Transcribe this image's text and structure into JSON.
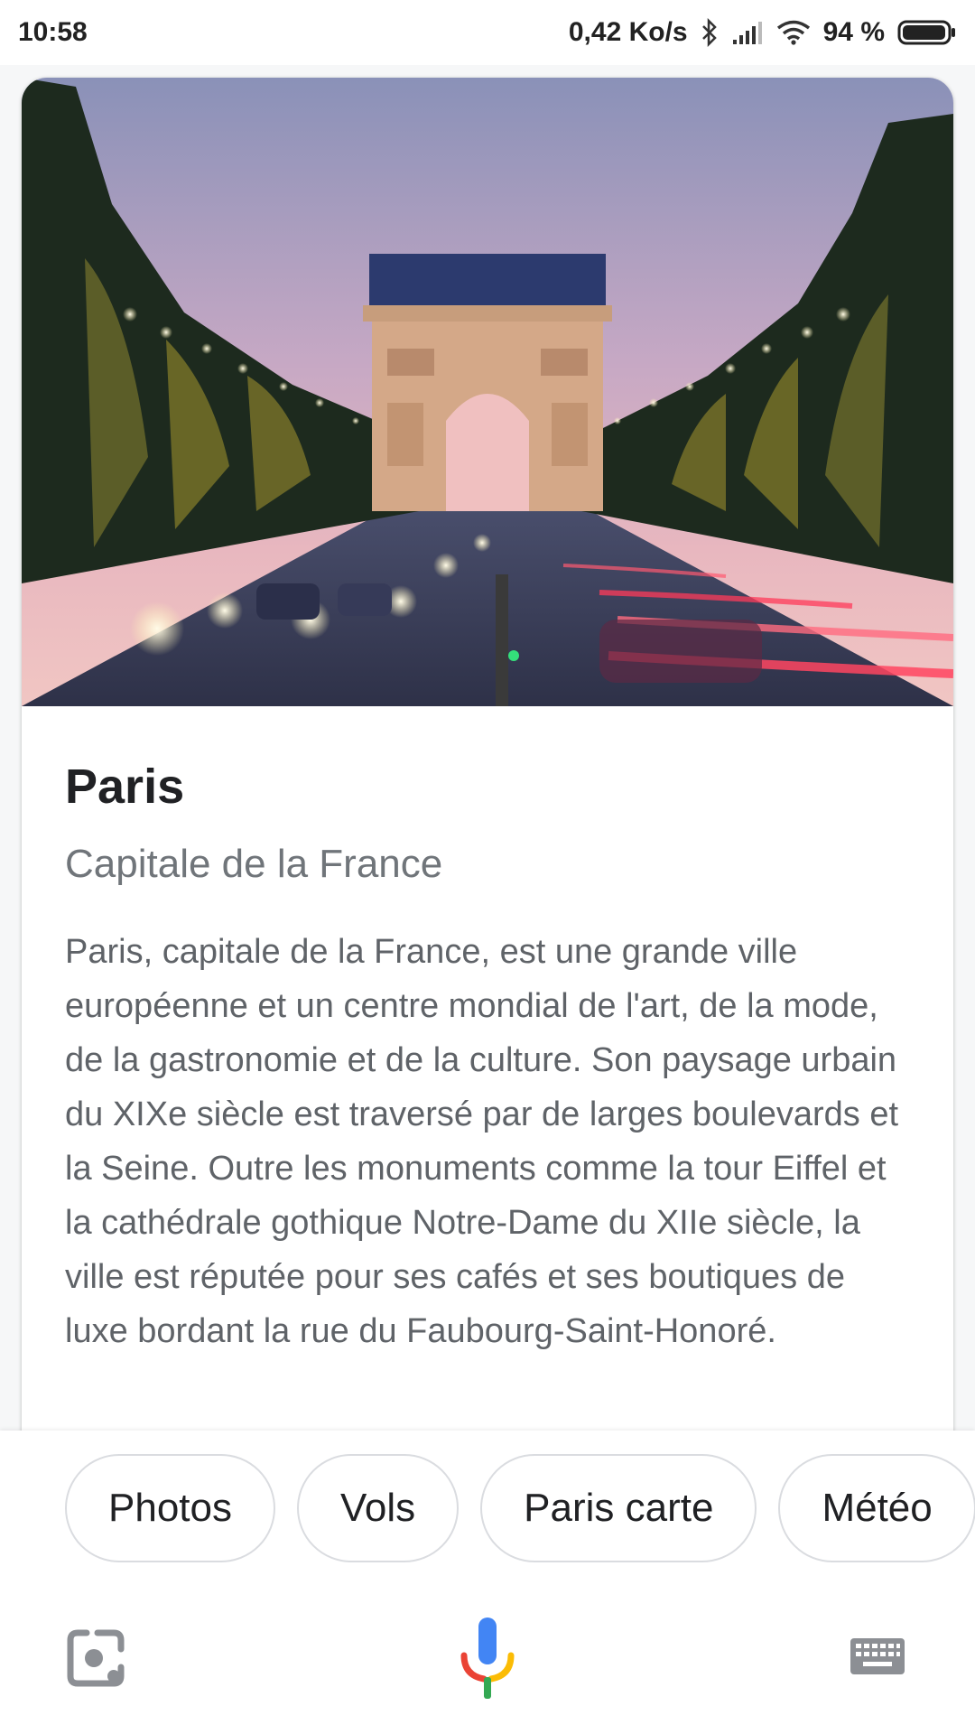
{
  "status_bar": {
    "time": "10:58",
    "net_speed": "0,42 Ko/s",
    "battery_percent": "94 %",
    "icons": [
      "bluetooth-icon",
      "signal-icon",
      "wifi-icon",
      "battery-icon"
    ]
  },
  "card": {
    "title": "Paris",
    "subtitle": "Capitale de la France",
    "description": "Paris, capitale de la France, est une grande ville européenne et un centre mondial de l'art, de la mode, de la gastronomie et de la culture. Son paysage urbain du XIXe siècle est traversé par de larges boulevards et la Seine. Outre les monuments comme la tour Eiffel et la cathédrale gothique Notre-Dame du XIIe siècle, la ville est réputée pour ses cafés et ses boutiques de luxe bordant la rue du Faubourg-Saint-Honoré."
  },
  "chips": [
    "Photos",
    "Vols",
    "Paris carte",
    "Météo"
  ],
  "bottom_bar": {
    "icons": [
      "lens-icon",
      "mic-icon",
      "keyboard-icon"
    ]
  },
  "colors": {
    "google_blue": "#4285f4",
    "google_red": "#ea4335",
    "google_yellow": "#fbbc05",
    "google_green": "#34a853"
  }
}
